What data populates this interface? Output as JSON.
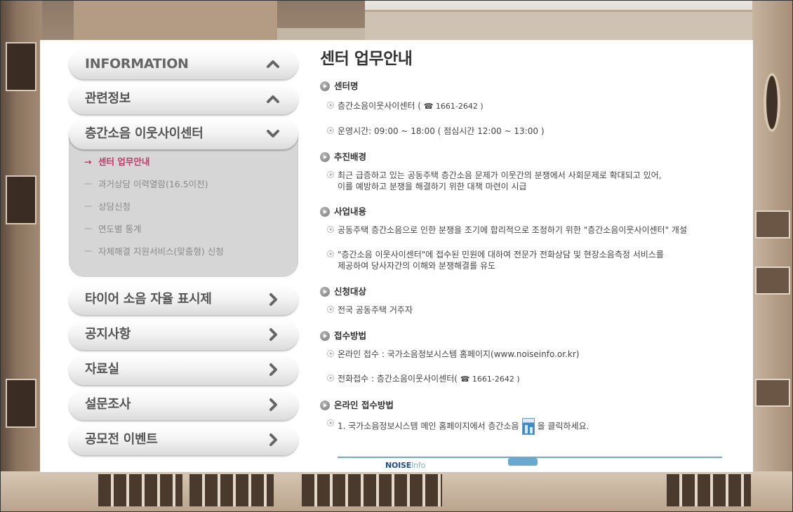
{
  "menu": {
    "information": "INFORMATION",
    "related": "관련정보",
    "center": "층간소음 이웃사이센터",
    "sub_items": [
      {
        "label": "센터 업무안내",
        "active": true
      },
      {
        "label": "과거상담 이력열람(16.5이전)",
        "active": false
      },
      {
        "label": "상담신청",
        "active": false
      },
      {
        "label": "연도별 통계",
        "active": false
      },
      {
        "label": "자체해결 지원서비스(맞춤형) 신청",
        "active": false
      }
    ],
    "active_arrow": "→",
    "dash": "ㅡ",
    "tire": "타이어 소음 자율 표시제",
    "notice": "공지사항",
    "archive": "자료실",
    "survey": "설문조사",
    "contest": "공모전 이벤트"
  },
  "content": {
    "title": "센터 업무안내",
    "sec_name": {
      "title": "센터명",
      "line1_text": "층간소음이웃사이센터 ( ",
      "line1_phone": "☎ 1661-2642 )",
      "line2": "운영시간: 09:00 ~ 18:00 ( 점심시간 12:00 ~ 13:00 )"
    },
    "sec_background": {
      "title": "추진배경",
      "line1": "최근 급증하고 있는 공동주택 층간소음 문제가 이웃간의 분쟁에서 사회문제로 확대되고 있어,",
      "line2": "이를 예방하고 분쟁을 해결하기 위한 대책 마련이 시급"
    },
    "sec_business": {
      "title": "사업내용",
      "line1": "공동주택 층간소음으로 인한 분쟁을 조기에 합리적으로 조정하기 위한 \"층간소음이웃사이센터\" 개설",
      "line2a": "\"층간소음 이웃사이센터\"에 접수된 민원에 대하여 전문가 전화상담 및 현장소음측정 서비스를",
      "line2b": "제공하여 당사자간의 이해와 분쟁해결를 유도"
    },
    "sec_target": {
      "title": "신청대상",
      "line1": "전국 공동주택 거주자"
    },
    "sec_method": {
      "title": "접수방법",
      "line1": "온라인 접수 : 국가소음정보시스템 홈페이지(www.noiseinfo.or.kr)",
      "line2_text": "전화접수 : 층간소음이웃사이센터( ",
      "line2_phone": "☎ 1661-2642 )"
    },
    "sec_online": {
      "title": "온라인 접수방법",
      "line1a": "1. 국가소음정보시스템 메인 홈페이지에서 층간소음",
      "line1b": "을 클릭하세요."
    }
  },
  "strip": {
    "logo_main": "NOISE",
    "logo_sub": "Info"
  }
}
